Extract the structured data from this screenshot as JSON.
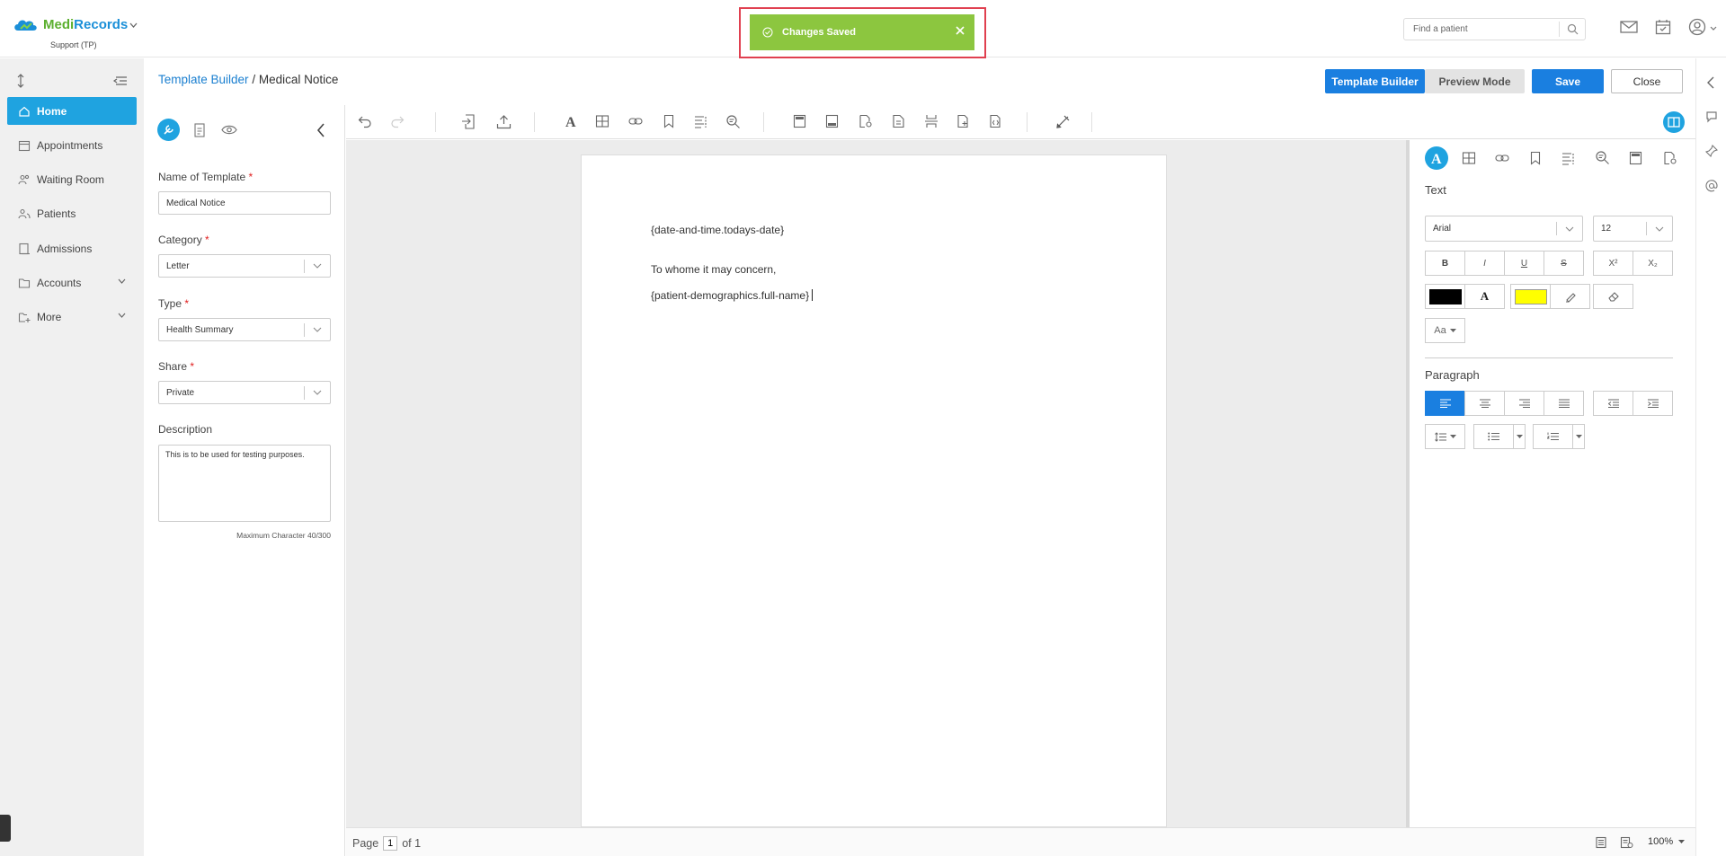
{
  "app": {
    "brand": "MediRecords",
    "brand_prefix": "Medi",
    "brand_suffix": "Records",
    "org": "Support (TP)"
  },
  "toast": {
    "message": "Changes Saved",
    "color": "#8cc63f"
  },
  "search": {
    "placeholder": "Find a patient"
  },
  "nav": {
    "items": [
      {
        "label": "Home",
        "icon": "home-icon",
        "active": true
      },
      {
        "label": "Appointments",
        "icon": "calendar-icon"
      },
      {
        "label": "Waiting Room",
        "icon": "people-icon"
      },
      {
        "label": "Patients",
        "icon": "patients-icon"
      },
      {
        "label": "Admissions",
        "icon": "admissions-icon"
      },
      {
        "label": "Accounts",
        "icon": "folder-icon",
        "expandable": true
      },
      {
        "label": "More",
        "icon": "more-icon",
        "expandable": true
      }
    ]
  },
  "breadcrumb": {
    "parent": "Template Builder",
    "separator": " / ",
    "current": "Medical Notice"
  },
  "actions": {
    "template_builder": "Template Builder",
    "preview_mode": "Preview Mode",
    "save": "Save",
    "close": "Close"
  },
  "form": {
    "name_label": "Name of Template",
    "name_value": "Medical Notice",
    "category_label": "Category",
    "category_value": "Letter",
    "type_label": "Type",
    "type_value": "Health Summary",
    "share_label": "Share",
    "share_value": "Private",
    "description_label": "Description",
    "description_value": "This is to be used for testing purposes.",
    "max_chars": "Maximum Character 40/300",
    "required_mark": "*"
  },
  "document": {
    "lines": [
      "{date-and-time.todays-date}",
      "To whome it may concern,",
      "{patient-demographics.full-name}"
    ]
  },
  "format": {
    "text_title": "Text",
    "font": "Arial",
    "size": "12",
    "paragraph_title": "Paragraph",
    "case_label": "Aa",
    "text_color": "#000000",
    "highlight_color": "#ffff00",
    "bold": "B",
    "italic": "I",
    "underline": "U",
    "strike": "S",
    "superscript": "X²",
    "subscript": "X₂",
    "font_color_letter": "A"
  },
  "status": {
    "page_label": "Page",
    "page_current": "1",
    "page_of": "of 1",
    "zoom": "100%"
  },
  "colors": {
    "accent": "#1fa3e0",
    "primary_button": "#1a7fe0",
    "required": "#e02020"
  }
}
